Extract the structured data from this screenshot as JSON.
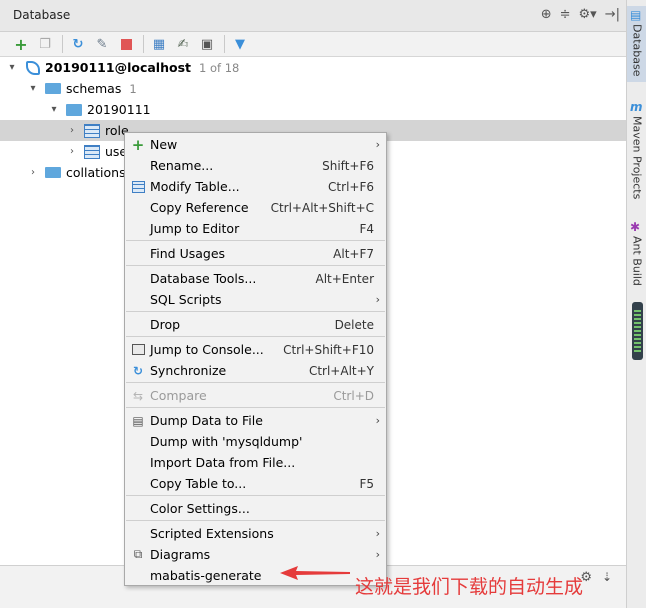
{
  "panel": {
    "title": "Database"
  },
  "tree": {
    "datasource": {
      "label": "20190111@localhost",
      "count": "1 of 18"
    },
    "schemas": {
      "label": "schemas",
      "count": "1"
    },
    "schema": {
      "label": "20190111"
    },
    "table_role": {
      "label": "role"
    },
    "table_user": {
      "label": "use"
    },
    "collations": {
      "label": "collations"
    }
  },
  "menu": {
    "items": [
      {
        "label": "New",
        "shortcut": "",
        "submenu": true
      },
      {
        "label": "Rename...",
        "shortcut": "Shift+F6"
      },
      {
        "label": "Modify Table...",
        "shortcut": "Ctrl+F6"
      },
      {
        "label": "Copy Reference",
        "shortcut": "Ctrl+Alt+Shift+C"
      },
      {
        "label": "Jump to Editor",
        "shortcut": "F4"
      },
      {
        "label": "Find Usages",
        "shortcut": "Alt+F7"
      },
      {
        "label": "Database Tools...",
        "shortcut": "Alt+Enter"
      },
      {
        "label": "SQL Scripts",
        "shortcut": "",
        "submenu": true
      },
      {
        "label": "Drop",
        "shortcut": "Delete"
      },
      {
        "label": "Jump to Console...",
        "shortcut": "Ctrl+Shift+F10"
      },
      {
        "label": "Synchronize",
        "shortcut": "Ctrl+Alt+Y"
      },
      {
        "label": "Compare",
        "shortcut": "Ctrl+D",
        "disabled": true
      },
      {
        "label": "Dump Data to File",
        "shortcut": "",
        "submenu": true
      },
      {
        "label": "Dump with 'mysqldump'",
        "shortcut": ""
      },
      {
        "label": "Import Data from File...",
        "shortcut": ""
      },
      {
        "label": "Copy Table to...",
        "shortcut": "F5"
      },
      {
        "label": "Color Settings...",
        "shortcut": ""
      },
      {
        "label": "Scripted Extensions",
        "shortcut": "",
        "submenu": true
      },
      {
        "label": "Diagrams",
        "shortcut": "",
        "submenu": true
      },
      {
        "label": "mabatis-generate",
        "shortcut": ""
      }
    ]
  },
  "side_tabs": {
    "database": "Database",
    "maven": "Maven Projects",
    "ant": "Ant Build"
  },
  "annotation": {
    "text": "这就是我们下载的自动生成"
  },
  "colors": {
    "accent": "#3b8fd9",
    "annotation": "#e53b3b",
    "selection": "#d4d4d4"
  }
}
